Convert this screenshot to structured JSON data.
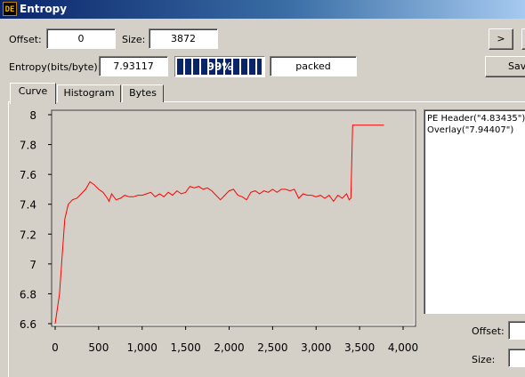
{
  "window": {
    "icon_text": "DE",
    "title": "Entropy"
  },
  "offset": {
    "label": "Offset:",
    "value": "0"
  },
  "size": {
    "label": "Size:",
    "value": "3872"
  },
  "entropy": {
    "label": "Entropy(bits/byte):",
    "value": "7.93117"
  },
  "progress": {
    "percent": 99,
    "text": "99%"
  },
  "status": {
    "value": "packed"
  },
  "buttons": {
    "next": ">",
    "save": "Save"
  },
  "tabs": [
    {
      "label": "Curve",
      "active": true
    },
    {
      "label": "Histogram",
      "active": false
    },
    {
      "label": "Bytes",
      "active": false
    }
  ],
  "legend": [
    {
      "label": "PE Header(\"4.83435\")"
    },
    {
      "label": "Overlay(\"7.94407\")"
    }
  ],
  "bottom": {
    "offset_label": "Offset:",
    "size_label": "Size:"
  },
  "colors": {
    "line": "#ff0000",
    "plot_bg": "#d4d0c8",
    "titlebar": "#0a246a"
  },
  "chart_data": {
    "type": "line",
    "xlim": [
      0,
      4000
    ],
    "ylim": [
      6.6,
      8.0
    ],
    "xticks": [
      "0",
      "500",
      "1,000",
      "1,500",
      "2,000",
      "2,500",
      "3,000",
      "3,500",
      "4,000"
    ],
    "yticks": [
      "6.6",
      "6.8",
      "7",
      "7.2",
      "7.4",
      "7.6",
      "7.8",
      "8"
    ],
    "grid": false,
    "series": [
      {
        "color": "#ff0000",
        "x": [
          0,
          50,
          80,
          110,
          150,
          200,
          250,
          300,
          350,
          400,
          450,
          500,
          550,
          600,
          620,
          650,
          700,
          750,
          800,
          850,
          900,
          950,
          1000,
          1050,
          1100,
          1150,
          1200,
          1250,
          1300,
          1350,
          1400,
          1450,
          1500,
          1550,
          1600,
          1650,
          1700,
          1750,
          1800,
          1850,
          1900,
          1950,
          2000,
          2050,
          2100,
          2150,
          2200,
          2250,
          2300,
          2350,
          2400,
          2450,
          2500,
          2550,
          2600,
          2650,
          2700,
          2750,
          2800,
          2850,
          2900,
          2950,
          3000,
          3050,
          3100,
          3150,
          3200,
          3250,
          3300,
          3350,
          3380,
          3400,
          3420,
          3450,
          3500,
          3600,
          3700,
          3780
        ],
        "y": [
          6.6,
          6.8,
          7.05,
          7.3,
          7.4,
          7.43,
          7.44,
          7.47,
          7.5,
          7.55,
          7.53,
          7.5,
          7.48,
          7.44,
          7.42,
          7.47,
          7.43,
          7.44,
          7.46,
          7.45,
          7.45,
          7.46,
          7.46,
          7.47,
          7.48,
          7.45,
          7.47,
          7.45,
          7.48,
          7.46,
          7.49,
          7.47,
          7.48,
          7.52,
          7.51,
          7.52,
          7.5,
          7.51,
          7.49,
          7.46,
          7.43,
          7.46,
          7.49,
          7.5,
          7.46,
          7.45,
          7.43,
          7.48,
          7.49,
          7.47,
          7.49,
          7.48,
          7.5,
          7.48,
          7.5,
          7.5,
          7.49,
          7.5,
          7.44,
          7.47,
          7.46,
          7.46,
          7.45,
          7.46,
          7.44,
          7.46,
          7.42,
          7.46,
          7.44,
          7.47,
          7.43,
          7.44,
          7.93,
          7.93,
          7.93,
          7.93,
          7.93,
          7.93
        ]
      }
    ]
  }
}
